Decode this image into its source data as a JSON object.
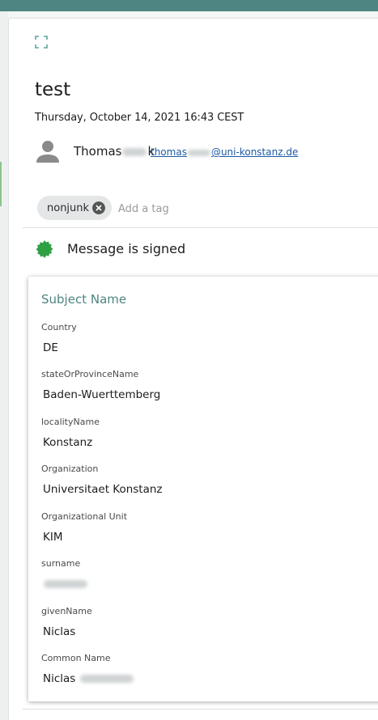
{
  "header": {
    "accent_color": "#4e8582"
  },
  "message": {
    "subject": "test",
    "date": "Thursday, October 14, 2021 16:43 CEST",
    "sender": {
      "name_visible": "Thomas",
      "name_suffix_visible": "k",
      "email_prefix": "thomas",
      "email_domain": "@uni-konstanz.de"
    }
  },
  "tags": {
    "items": [
      {
        "label": "nonjunk"
      }
    ],
    "add_placeholder": "Add a tag"
  },
  "signature": {
    "status_text": "Message is signed",
    "status_color": "#2ea043"
  },
  "certificate": {
    "title": "Subject Name",
    "fields": [
      {
        "label": "Country",
        "value": "DE"
      },
      {
        "label": "stateOrProvinceName",
        "value": "Baden-Wuerttemberg"
      },
      {
        "label": "localityName",
        "value": "Konstanz"
      },
      {
        "label": "Organization",
        "value": "Universitaet Konstanz"
      },
      {
        "label": "Organizational Unit",
        "value": "KIM"
      },
      {
        "label": "surname",
        "value": ""
      },
      {
        "label": "givenName",
        "value": "Niclas"
      },
      {
        "label": "Common Name",
        "value": "Niclas"
      }
    ]
  },
  "icons": {
    "expand": "expand-icon",
    "avatar": "person-icon",
    "remove_tag": "close-circle-icon",
    "signed": "certificate-seal-icon"
  }
}
